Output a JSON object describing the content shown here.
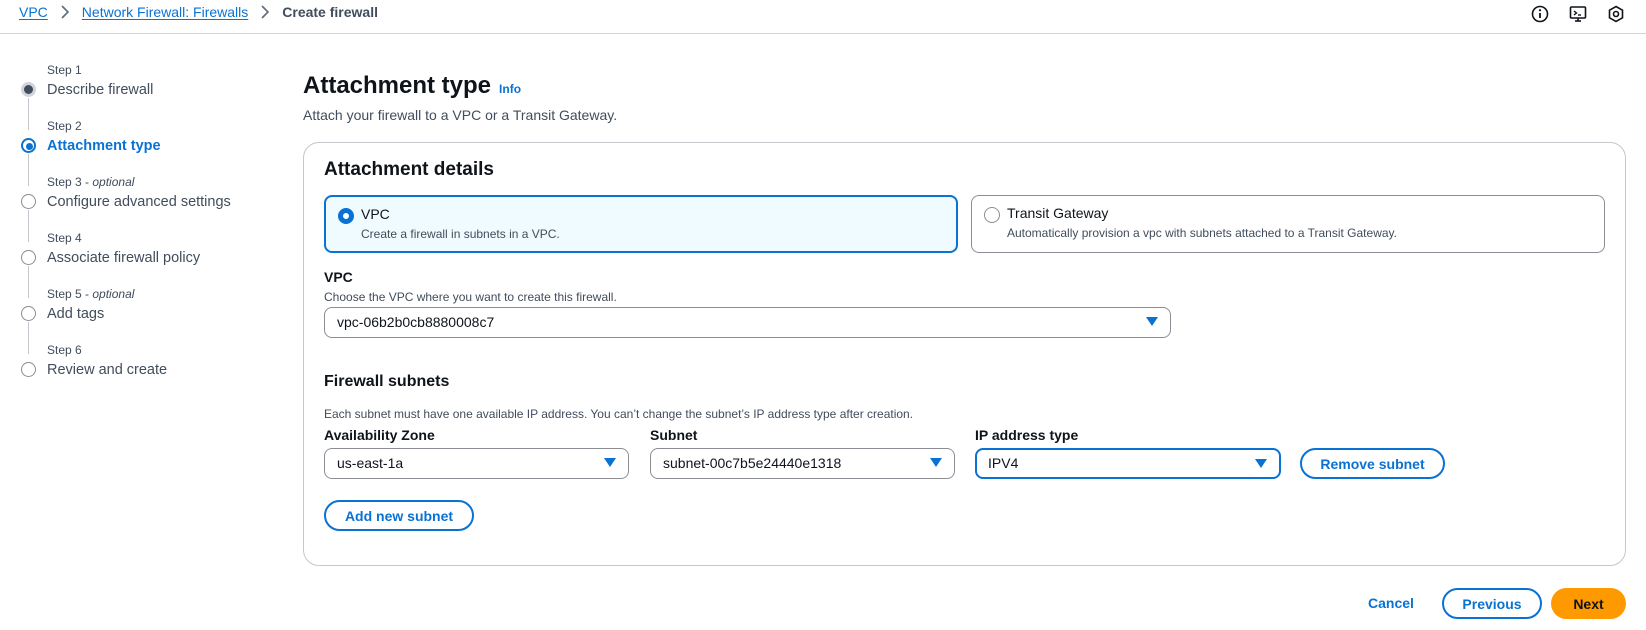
{
  "breadcrumb": {
    "items": [
      "VPC",
      "Network Firewall: Firewalls"
    ],
    "current": "Create firewall"
  },
  "top_icons": [
    "info-icon",
    "cloudshell-icon",
    "settings-icon"
  ],
  "steps": [
    {
      "number": "Step 1",
      "optional": "",
      "title": "Describe firewall",
      "state": "done"
    },
    {
      "number": "Step 2",
      "optional": "",
      "title": "Attachment type",
      "state": "active"
    },
    {
      "number": "Step 3",
      "optional": "optional",
      "title": "Configure advanced settings",
      "state": "todo"
    },
    {
      "number": "Step 4",
      "optional": "",
      "title": "Associate firewall policy",
      "state": "todo"
    },
    {
      "number": "Step 5",
      "optional": "optional",
      "title": "Add tags",
      "state": "todo"
    },
    {
      "number": "Step 6",
      "optional": "",
      "title": "Review and create",
      "state": "todo"
    }
  ],
  "step_optional_separator": " - ",
  "page": {
    "title": "Attachment type",
    "info": "Info",
    "description": "Attach your firewall to a VPC or a Transit Gateway."
  },
  "details": {
    "title": "Attachment details",
    "tiles": [
      {
        "label": "VPC",
        "description": "Create a firewall in subnets in a VPC.",
        "selected": true
      },
      {
        "label": "Transit Gateway",
        "description": "Automatically provision a vpc with subnets attached to a Transit Gateway.",
        "selected": false
      }
    ],
    "vpc": {
      "label": "VPC",
      "description": "Choose the VPC where you want to create this firewall.",
      "value": "vpc-06b2b0cb8880008c7"
    },
    "subnets": {
      "title": "Firewall subnets",
      "description": "Each subnet must have one available IP address. You can’t change the subnet’s IP address type after creation.",
      "az_label": "Availability Zone",
      "az_value": "us-east-1a",
      "subnet_label": "Subnet",
      "subnet_value": "subnet-00c7b5e24440e1318",
      "ip_label": "IP address type",
      "ip_value": "IPV4",
      "remove_label": "Remove subnet",
      "add_label": "Add new subnet"
    }
  },
  "footer": {
    "cancel": "Cancel",
    "previous": "Previous",
    "next": "Next"
  },
  "colors": {
    "accent": "#0972d3",
    "primary_button": "#ff9900",
    "selected_tile_bg": "#f0fbff"
  }
}
